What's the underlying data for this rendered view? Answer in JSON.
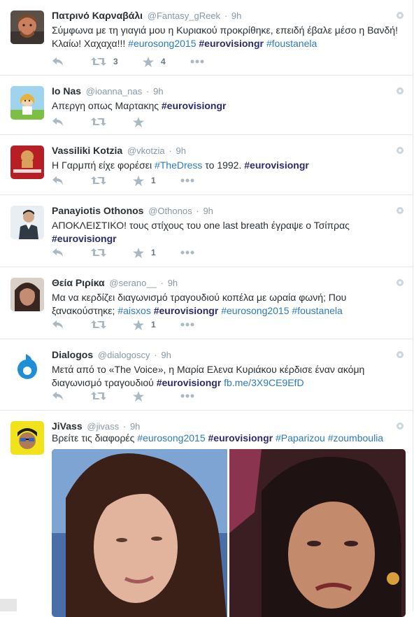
{
  "tweets": [
    {
      "fullname": "Πατρινό Καρναβάλι",
      "handle": "@Fantasy_gReek",
      "time": "9h",
      "text_plain": "Σύμφωνα με τη γιαγιά μου η Κυριακού προκρίθηκε, επειδή έβαλε μέσο η Βανδή! Κλαίω! Χαχαχα!!! ",
      "tags": [
        "#eurosong2015",
        "#eurovisiongr",
        "#foustanela"
      ],
      "retweets": "3",
      "favorites": "4"
    },
    {
      "fullname": "Io Nas",
      "handle": "@ioanna_nas",
      "time": "9h",
      "text_plain": "Απεργη οπως Μαρτακης ",
      "tags": [
        "#eurovisiongr"
      ],
      "retweets": "",
      "favorites": ""
    },
    {
      "fullname": "Vassiliki Kotzia",
      "handle": "@vkotzia",
      "time": "9h",
      "text_plain": "Η Γαρμπή είχε φορέσει ",
      "tag_mid": "#TheDress",
      "text_after": " το 1992. ",
      "tags": [
        "#eurovisiongr"
      ],
      "retweets": "",
      "favorites": "1"
    },
    {
      "fullname": "Panayiotis Othonos",
      "handle": "@Othonos",
      "time": "9h",
      "text_plain": "ΑΠΟΚΛΕΙΣΤΙΚΟ! τους στίχους του one last breath έγραψε ο Τσίπρας ",
      "tags": [
        "#eurovisiongr"
      ],
      "retweets": "",
      "favorites": "1"
    },
    {
      "fullname": "Θεία Ριρίκα",
      "handle": "@serano__",
      "time": "9h",
      "text_plain": "Μα να κερδίζει διαγωνισμό τραγουδιού κοπέλα με ωραία φωνή; Που ξανακούστηκε; ",
      "tags": [
        "#aisxos",
        "#eurovisiongr",
        "#eurosong2015",
        "#foustanela"
      ],
      "retweets": "",
      "favorites": "1"
    },
    {
      "fullname": "Dialogos",
      "handle": "@dialogoscy",
      "time": "9h",
      "text_plain": "Μετά από το «The Voice», η Μαρία Ελενα Κυριάκου κέρδισε έναν ακόμη διαγωνισμό τραγουδιού ",
      "tags": [
        "#eurovisiongr"
      ],
      "link": "fb.me/3X9CE9EfD",
      "retweets": "",
      "favorites": ""
    },
    {
      "fullname": "JiVass",
      "handle": "@jivass",
      "time": "9h",
      "text_plain": "Βρείτε τις διαφορές  ",
      "tags": [
        "#eurosong2015",
        "#eurovisiongr",
        "#Paparizou",
        "#zoumboulia"
      ]
    }
  ],
  "separator_dot": "·",
  "icons": {
    "reply": "reply-icon",
    "retweet": "retweet-icon",
    "favorite": "star-icon",
    "more": "ellipsis-icon",
    "globe": "globe-icon"
  },
  "colors": {
    "link": "#2b7bb9",
    "hashtag_bold": "#2b2b6b",
    "meta": "#8899a6",
    "action": "#aab8c2",
    "border": "#e1e8ed"
  }
}
